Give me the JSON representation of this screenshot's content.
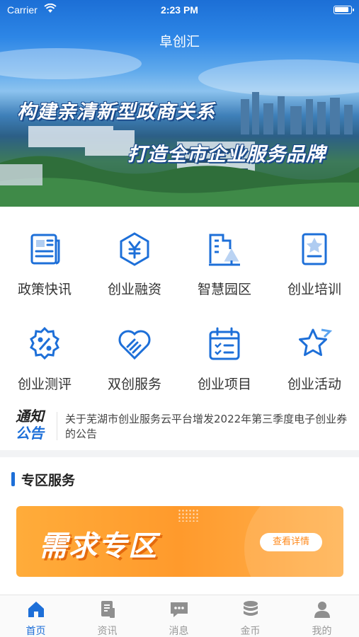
{
  "status_bar": {
    "carrier": "Carrier",
    "time": "2:23 PM"
  },
  "header": {
    "title": "阜创汇"
  },
  "hero": {
    "slogan_line1": "构建亲清新型政商关系",
    "slogan_line2": "打造全市企业服务品牌"
  },
  "services": [
    {
      "label": "政策快讯",
      "icon": "news-icon"
    },
    {
      "label": "创业融资",
      "icon": "yuan-hexagon-icon"
    },
    {
      "label": "智慧园区",
      "icon": "park-building-icon"
    },
    {
      "label": "创业培训",
      "icon": "certificate-icon"
    },
    {
      "label": "创业测评",
      "icon": "percent-badge-icon"
    },
    {
      "label": "双创服务",
      "icon": "handshake-heart-icon"
    },
    {
      "label": "创业项目",
      "icon": "calendar-checklist-icon"
    },
    {
      "label": "创业活动",
      "icon": "star-icon"
    }
  ],
  "notice": {
    "tag_line1": "通知",
    "tag_line2": "公告",
    "text": "关于芜湖市创业服务云平台增发2022年第三季度电子创业券的公告"
  },
  "section": {
    "title": "专区服务"
  },
  "banner": {
    "title": "需求专区",
    "button": "查看详情"
  },
  "tabbar": [
    {
      "label": "首页",
      "icon": "home-icon",
      "active": true
    },
    {
      "label": "资讯",
      "icon": "document-icon",
      "active": false
    },
    {
      "label": "消息",
      "icon": "chat-icon",
      "active": false
    },
    {
      "label": "金币",
      "icon": "coins-icon",
      "active": false
    },
    {
      "label": "我的",
      "icon": "user-icon",
      "active": false
    }
  ],
  "colors": {
    "accent": "#1d6fd8",
    "orange": "#ff9a2c",
    "tab_inactive": "#999999"
  }
}
